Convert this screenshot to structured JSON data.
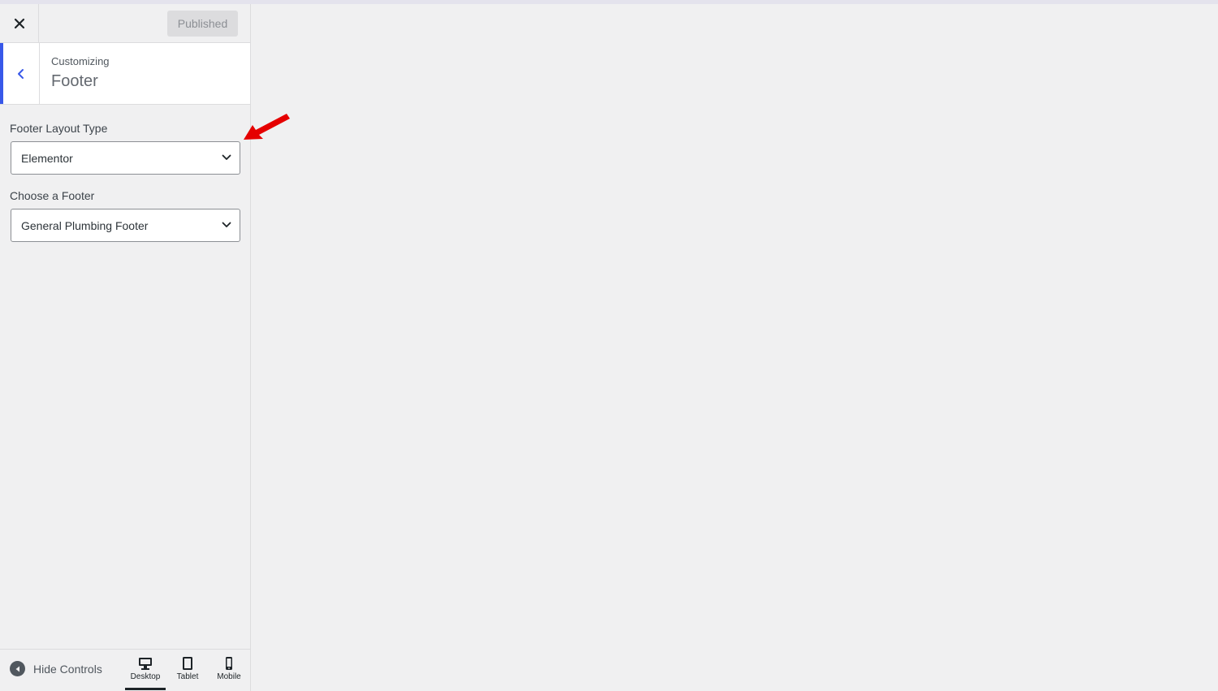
{
  "header": {
    "close_icon": "close-icon",
    "publish_label": "Published"
  },
  "section": {
    "customizing_label": "Customizing",
    "title": "Footer",
    "back_icon": "chevron-left-icon",
    "accent": "#3858e9"
  },
  "controls": [
    {
      "label": "Footer Layout Type",
      "value": "Elementor"
    },
    {
      "label": "Choose a Footer",
      "value": "General Plumbing Footer"
    }
  ],
  "footer": {
    "hide_label": "Hide Controls",
    "devices": [
      {
        "label": "Desktop",
        "icon": "desktop-icon",
        "active": true
      },
      {
        "label": "Tablet",
        "icon": "tablet-icon",
        "active": false
      },
      {
        "label": "Mobile",
        "icon": "mobile-icon",
        "active": false
      }
    ]
  },
  "annotation": {
    "arrow_color": "#e50000"
  }
}
